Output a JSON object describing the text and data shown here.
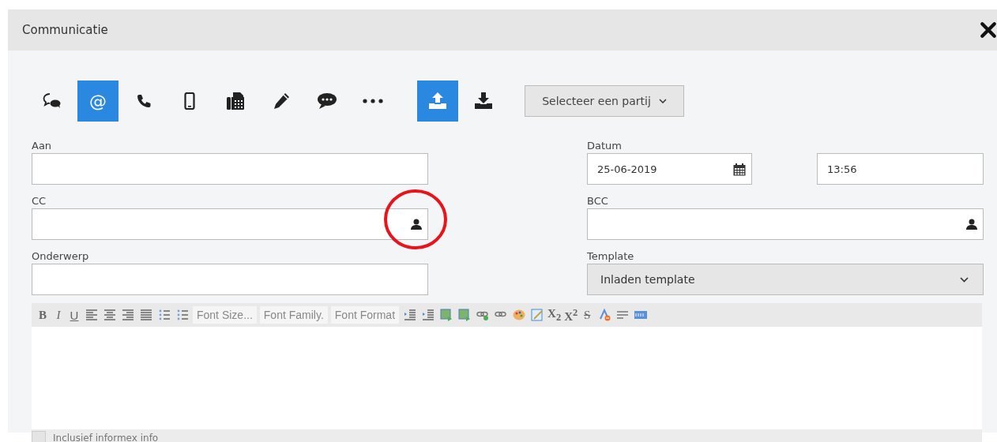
{
  "window": {
    "title": "Communicatie"
  },
  "channel_types": [
    {
      "kind": "icon",
      "selected": false
    },
    {
      "kind": "text",
      "label": "@",
      "selected": true
    },
    {
      "kind": "icon",
      "selected": false
    },
    {
      "kind": "icon",
      "selected": false
    },
    {
      "kind": "icon",
      "selected": false
    },
    {
      "kind": "icon",
      "selected": false
    },
    {
      "kind": "icon",
      "selected": false
    },
    {
      "kind": "icon",
      "selected": false
    }
  ],
  "direction": [
    {
      "selected": true
    },
    {
      "selected": false
    }
  ],
  "party_select": {
    "value": "Selecteer een partij"
  },
  "fields": {
    "aan": {
      "label": "Aan"
    },
    "cc": {
      "label": "CC"
    },
    "onderwerp": {
      "label": "Onderwerp"
    },
    "datum": {
      "label": "Datum",
      "value": "25-06-2019"
    },
    "time": {
      "value": "13:56"
    },
    "bcc": {
      "label": "BCC"
    },
    "template": {
      "label": "Template",
      "value": "Inladen template"
    }
  },
  "editor_toolbar": [
    {
      "kind": "bold",
      "label": "B"
    },
    {
      "kind": "italic",
      "label": "I"
    },
    {
      "kind": "underline",
      "label": "U"
    },
    {
      "kind": "icon"
    },
    {
      "kind": "icon"
    },
    {
      "kind": "icon"
    },
    {
      "kind": "icon"
    },
    {
      "kind": "icon"
    },
    {
      "kind": "icon"
    },
    {
      "kind": "select",
      "label": "Font Size..."
    },
    {
      "kind": "select",
      "label": "Font Family."
    },
    {
      "kind": "select",
      "label": "Font Format"
    },
    {
      "kind": "icon"
    },
    {
      "kind": "icon"
    },
    {
      "kind": "icon"
    },
    {
      "kind": "icon"
    },
    {
      "kind": "icon"
    },
    {
      "kind": "icon"
    },
    {
      "kind": "icon"
    },
    {
      "kind": "icon"
    },
    {
      "kind": "script",
      "label": "X$_{2}$"
    },
    {
      "kind": "script",
      "label": "X$^{2}$"
    },
    {
      "kind": "strike",
      "label": "S"
    },
    {
      "kind": "icon"
    },
    {
      "kind": "icon"
    },
    {
      "kind": "icon"
    }
  ],
  "include_info": {
    "label": "Inclusief informex info",
    "checked": false
  }
}
